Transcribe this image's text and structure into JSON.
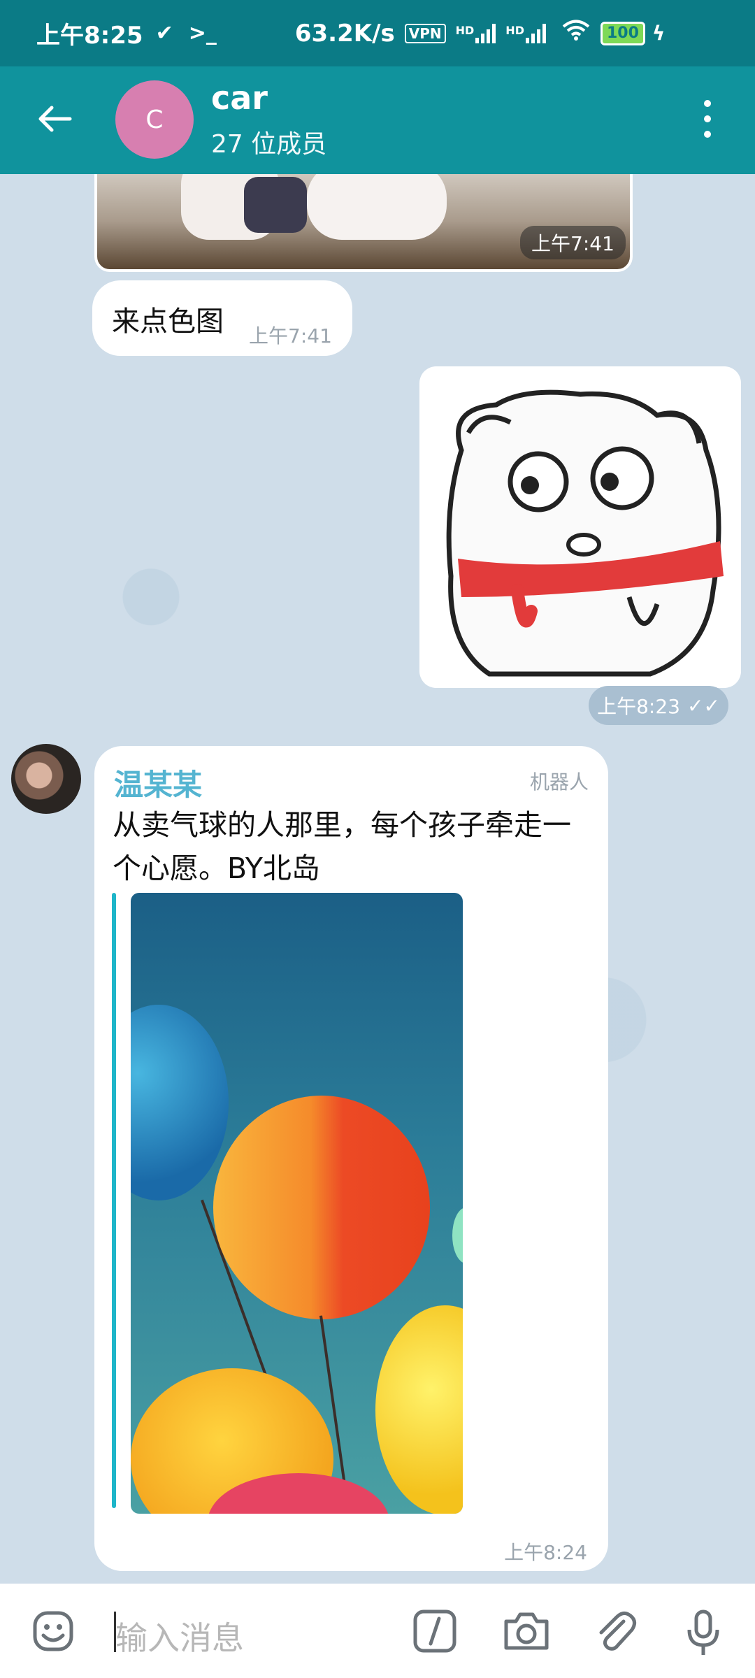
{
  "status_bar": {
    "time": "上午8:25",
    "net_speed": "63.2K/s",
    "vpn": "VPN",
    "signal1_label": "HD",
    "signal2_label": "HD",
    "battery": "100"
  },
  "header": {
    "avatar_letter": "C",
    "title": "car",
    "subtitle": "27 位成员"
  },
  "messages": {
    "photo_time": "上午7:41",
    "text1": "来点色图",
    "text1_time": "上午7:41",
    "sticker_time": "上午8:23",
    "bot_sender": "温某某",
    "bot_badge": "机器人",
    "bot_text": " 从卖气球的人那里，每个孩子牵走一个心愿。BY北岛",
    "bot_time": "上午8:24"
  },
  "input": {
    "placeholder": "输入消息"
  }
}
